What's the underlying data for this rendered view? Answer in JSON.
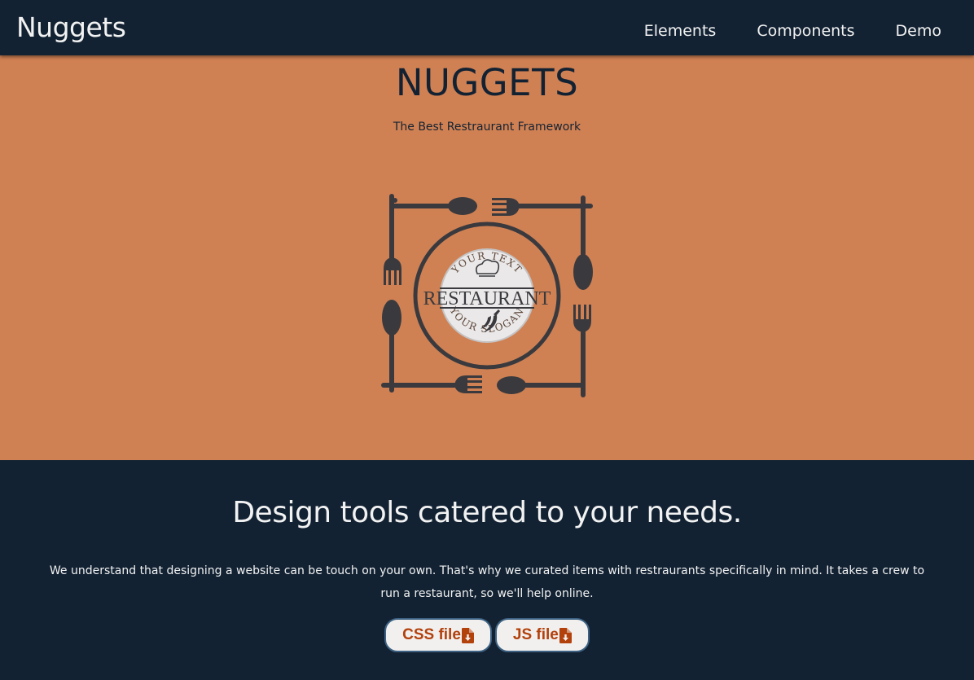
{
  "nav": {
    "brand": "Nuggets",
    "links": [
      {
        "label": "Elements"
      },
      {
        "label": "Components"
      },
      {
        "label": "Demo"
      }
    ]
  },
  "hero": {
    "title": "NUGGETS",
    "subtitle": "The Best Restraurant Framework",
    "logo": {
      "top_text": "YOUR TEXT",
      "name": "RESTAURANT",
      "bottom_text": "YOUR SLOGAN",
      "icons": [
        "chef-hat-icon",
        "chili-pepper-icon",
        "fork-icon",
        "spoon-icon"
      ]
    }
  },
  "section": {
    "heading": "Design tools catered to your needs.",
    "body": "We understand that designing a website can be touch on your own. That's why we curated items with restraurants specifically in mind. It takes a crew to run a restaurant, so we'll help online.",
    "buttons": [
      {
        "label": "CSS file",
        "icon": "file-download-icon"
      },
      {
        "label": "JS file",
        "icon": "file-download-icon"
      }
    ]
  },
  "colors": {
    "navbar_bg": "#122233",
    "hero_bg": "#D08153",
    "button_text": "#B2410C",
    "button_border": "#3D6283",
    "logo_dark": "#3A3A3E"
  }
}
